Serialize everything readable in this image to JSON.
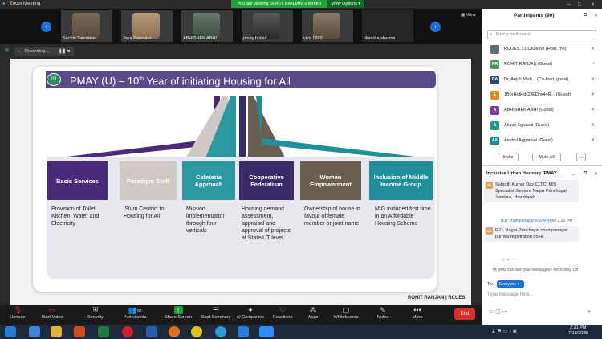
{
  "window": {
    "title": "Zoom Meeting",
    "viewing_banner": "You are viewing ROHIT RANJAN 's screen",
    "view_options": "View Options",
    "view_label": "View"
  },
  "video_strip": [
    {
      "name": "Sachin Tamrakar"
    },
    {
      "name": "Jaya Pamnani"
    },
    {
      "name": "ABHISHEK ABHI"
    },
    {
      "name": "pmay bhilai"
    },
    {
      "name": "vivo 1920"
    },
    {
      "name": "tikendra sharma"
    }
  ],
  "recording": {
    "label": "Recording...",
    "pause": "❚❚",
    "stop": "■"
  },
  "slide": {
    "number": "03",
    "title_prefix": "PMAY (U) – 10",
    "title_sup": "th",
    "title_suffix": " Year of initiating Housing for All",
    "presenter": "ROHIT RANJAN | RCUES",
    "boxes": [
      {
        "label": "Basic Services",
        "color": "#4a2a78",
        "desc": "Provision of Toilet, Kitchen, Water and Electricity"
      },
      {
        "label": "Paradigm Shift",
        "color": "#cfc8c4",
        "desc": "'Slum Centric' to Housing for All"
      },
      {
        "label": "Cafeteria Approach",
        "color": "#2a9aa0",
        "desc": "Mission implementation through four verticals"
      },
      {
        "label": "Cooperative Federalism",
        "color": "#3a2a6a",
        "desc": "Housing demand assessment, appraisal and approval of projects at State/UT level"
      },
      {
        "label": "Women Empowerment",
        "color": "#6a5e52",
        "desc": "Ownership of house in favour of female member or joint name"
      },
      {
        "label": "Inclusion of Middle Income Group",
        "color": "#1f8f9a",
        "desc": "MIG included first time in an Affordable Housing Scheme"
      }
    ]
  },
  "toolbar": {
    "items": [
      {
        "label": "Unmute",
        "icon": "mic-muted-icon"
      },
      {
        "label": "Start Video",
        "icon": "video-off-icon"
      },
      {
        "label": "Security",
        "icon": "shield-icon"
      },
      {
        "label": "Participants",
        "icon": "people-icon",
        "count": "90"
      },
      {
        "label": "Share Screen",
        "icon": "share-screen-icon"
      },
      {
        "label": "Start Summary",
        "icon": "summary-icon"
      },
      {
        "label": "AI Companion",
        "icon": "sparkle-icon"
      },
      {
        "label": "Reactions",
        "icon": "heart-icon"
      },
      {
        "label": "Apps",
        "icon": "apps-icon"
      },
      {
        "label": "Whiteboards",
        "icon": "whiteboard-icon"
      },
      {
        "label": "Notes",
        "icon": "notes-icon"
      },
      {
        "label": "More",
        "icon": "more-icon"
      }
    ],
    "end_label": "End"
  },
  "participants": {
    "title": "Participants (90)",
    "search_placeholder": "Find a participant",
    "list": [
      {
        "initials": "",
        "name": "RCUES, LUCKNOW (Host, me)",
        "color": "#5b6b7a"
      },
      {
        "initials": "RR",
        "name": "ROHIT RANJAN (Guest)",
        "color": "#4a9a5a"
      },
      {
        "initials": "DA",
        "name": "Dr. Anjuli Mish... (Co-host, guest)",
        "color": "#2e4a7a"
      },
      {
        "initials": "1",
        "name": "1B5rHotHdCDEDhx44R... (Guest)",
        "color": "#e08a20"
      },
      {
        "initials": "A",
        "name": "ABHISHEK ABHI (Guest)",
        "color": "#7a3aa0"
      },
      {
        "initials": "A",
        "name": "Akash Agrawal (Guest)",
        "color": "#1a9a8a"
      },
      {
        "initials": "AA",
        "name": "Anshul Aggarwal (Guest)",
        "color": "#1a8a9a"
      }
    ],
    "invite_label": "Invite",
    "mute_all_label": "Mute All",
    "more_label": "..."
  },
  "chat": {
    "title": "Inclusive Urban Housing (PMAY ...",
    "messages": [
      {
        "avatar": "SK",
        "text": "Subodh Kumar Das CLTC, MIS Specialist Jamtara Nagar Panchayat Jamtara, Jharkhand"
      },
      {
        "avatar": "NC",
        "sender": "N.p. champanagar",
        "to_prefix": "to",
        "to": "Everyone",
        "time": "2:20 PM",
        "text": "E.O. Nagar Panchayat champanagar purnea registration done."
      }
    ],
    "who_can_see": "Who can see your messages? Recording On",
    "to_label": "To:",
    "to_value": "Everyone",
    "input_placeholder": "Type message here..."
  },
  "taskbar": {
    "time": "2:21 PM",
    "date": "7/18/2025"
  }
}
